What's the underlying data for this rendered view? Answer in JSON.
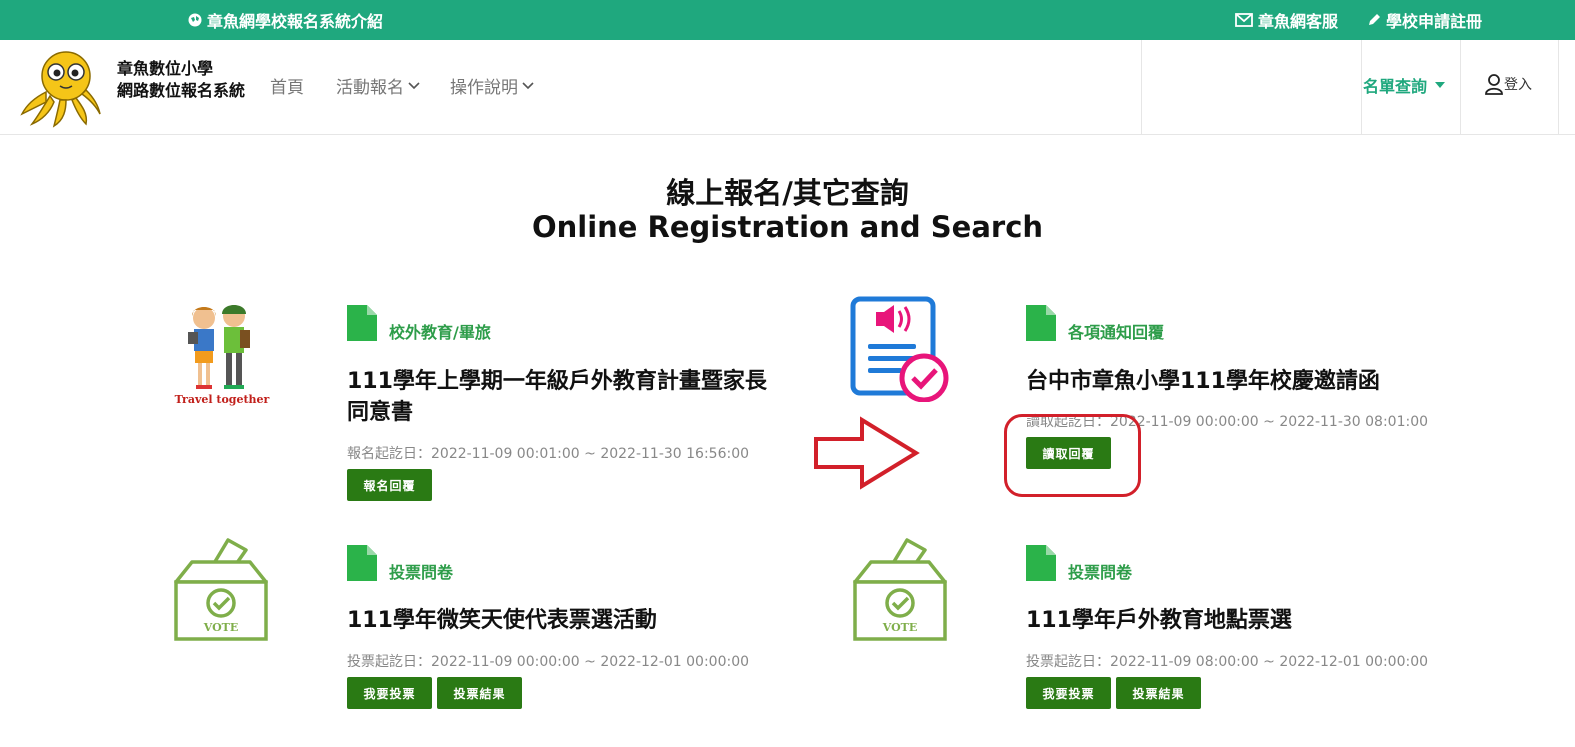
{
  "topbar": {
    "intro": "章魚網學校報名系統介紹",
    "service": "章魚網客服",
    "register": "學校申請註冊"
  },
  "navbar": {
    "brand_line1": "章魚數位小學",
    "brand_line2": "網路數位報名系統",
    "home": "首頁",
    "activities": "活動報名",
    "instructions": "操作說明",
    "roster": "名單查詢",
    "login": "登入"
  },
  "heading": {
    "zh": "線上報名/其它查詢",
    "en": "Online Registration and Search"
  },
  "cards": [
    {
      "category": "校外教育/畢旅",
      "title_line1": "111學年上學期一年級戶外教育計畫暨家長",
      "title_line2": "同意書",
      "date": "報名起訖日：2022-11-09 00:01:00 ~ 2022-11-30 16:56:00",
      "buttons": [
        "報名回覆"
      ],
      "image_text": "Travel together"
    },
    {
      "category": "各項通知回覆",
      "title_line1": "台中市章魚小學111學年校慶邀請函",
      "date": "讀取起訖日：2022-11-09 00:00:00 ~ 2022-11-30 08:01:00",
      "buttons": [
        "讀取回覆"
      ]
    },
    {
      "category": "投票問卷",
      "title_line1": "111學年微笑天使代表票選活動",
      "date": "投票起訖日：2022-11-09 00:00:00 ~ 2022-12-01 00:00:00",
      "buttons": [
        "我要投票",
        "投票結果"
      ],
      "image_text": "VOTE"
    },
    {
      "category": "投票問卷",
      "title_line1": "111學年戶外教育地點票選",
      "date": "投票起訖日：2022-11-09 08:00:00 ~ 2022-12-01 00:00:00",
      "buttons": [
        "我要投票",
        "投票結果"
      ],
      "image_text": "VOTE"
    }
  ],
  "colors": {
    "topbar": "#1fa87e",
    "button": "#2a7a14",
    "category": "#2e9d4a",
    "annotation": "#d2202a"
  }
}
